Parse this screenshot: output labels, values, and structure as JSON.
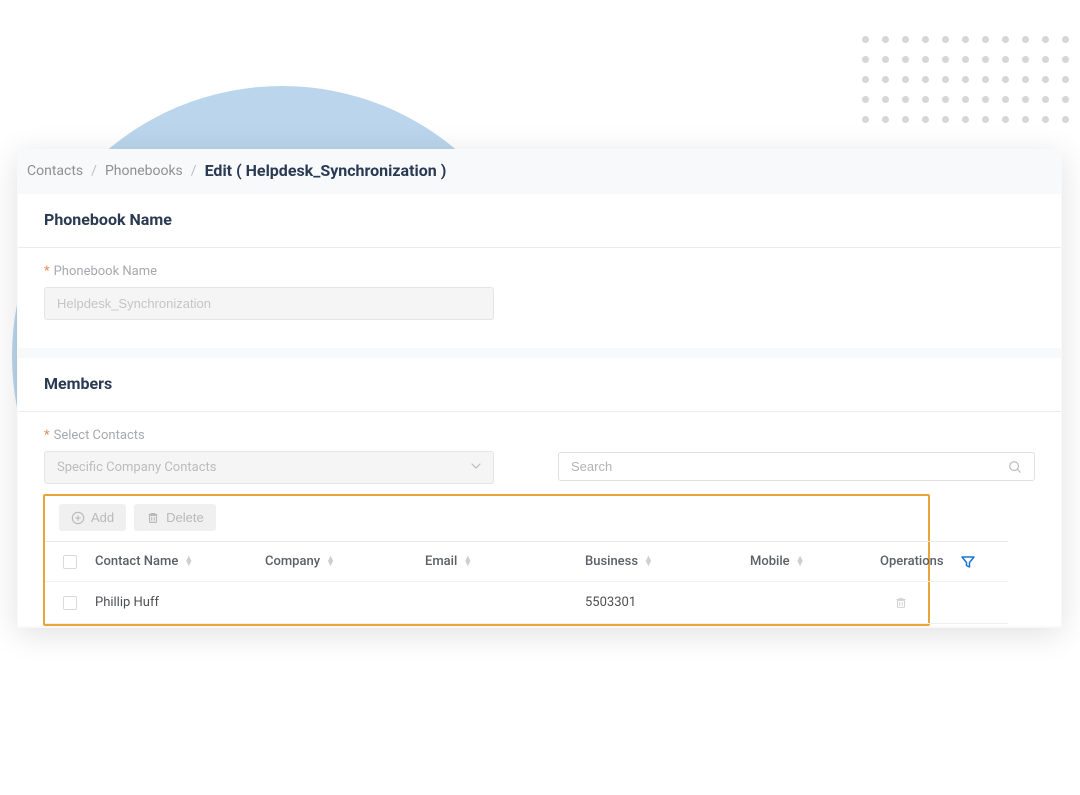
{
  "breadcrumb": {
    "contacts": "Contacts",
    "phonebooks": "Phonebooks",
    "current": "Edit ( Helpdesk_Synchronization )"
  },
  "sections": {
    "phonebook_name": {
      "title": "Phonebook Name",
      "field_label": "Phonebook Name",
      "value": "Helpdesk_Synchronization"
    },
    "members": {
      "title": "Members",
      "select_contacts_label": "Select Contacts",
      "select_contacts_value": "Specific Company Contacts",
      "search_placeholder": "Search",
      "add_btn": "Add",
      "delete_btn": "Delete",
      "columns": {
        "contact_name": "Contact Name",
        "company": "Company",
        "email": "Email",
        "business": "Business",
        "mobile": "Mobile",
        "operations": "Operations"
      },
      "rows": [
        {
          "contact_name": "Phillip Huff",
          "company": "",
          "email": "",
          "business": "5503301",
          "mobile": ""
        }
      ]
    }
  }
}
